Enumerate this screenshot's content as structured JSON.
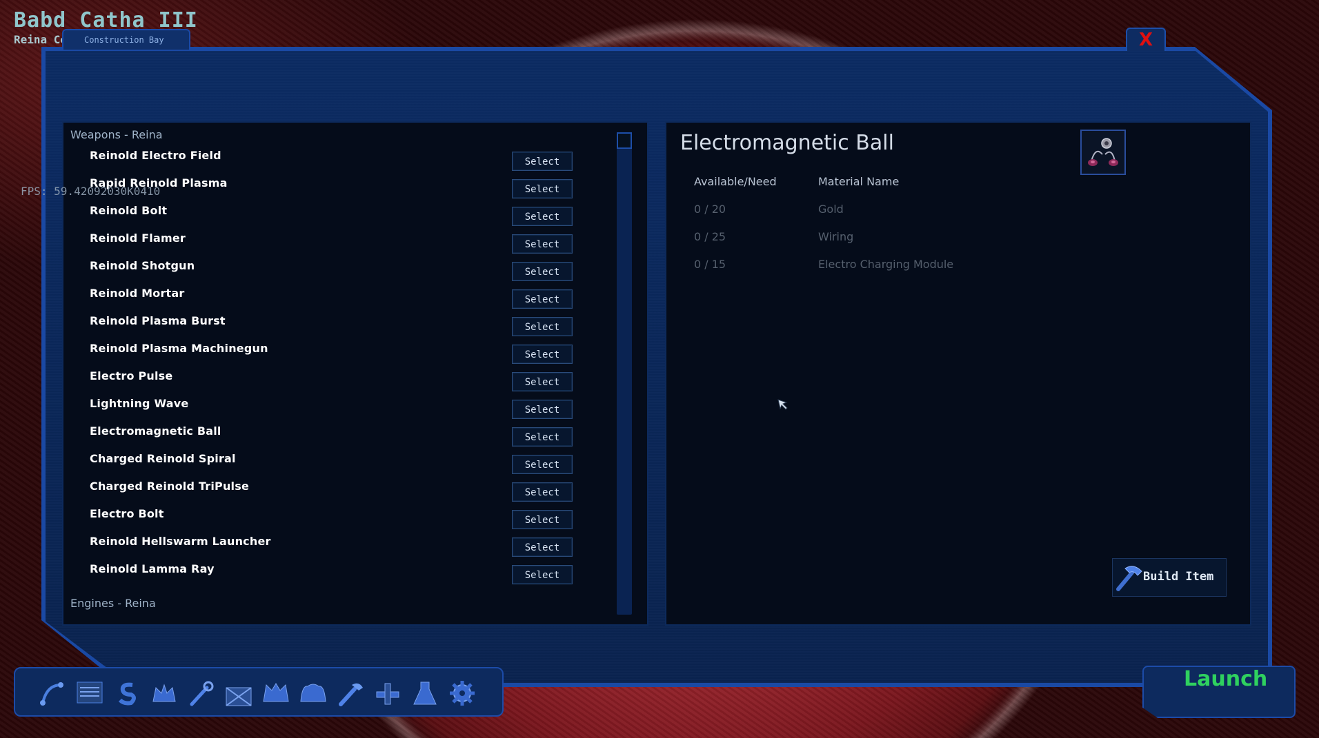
{
  "planet": {
    "name": "Babd Catha III",
    "subtitle": "Reina Co"
  },
  "tab": {
    "label": "Construction Bay"
  },
  "close": {
    "label": "X"
  },
  "fps": "FPS: 59.42092030K0410",
  "list": {
    "category_weapons": "Weapons - Reina",
    "category_engines": "Engines - Reina",
    "select_label": "Select",
    "items": [
      {
        "name": "Reinold Electro Field"
      },
      {
        "name": "Rapid Reinold Plasma"
      },
      {
        "name": "Reinold Bolt"
      },
      {
        "name": "Reinold Flamer"
      },
      {
        "name": "Reinold Shotgun"
      },
      {
        "name": "Reinold Mortar"
      },
      {
        "name": "Reinold Plasma Burst"
      },
      {
        "name": "Reinold Plasma Machinegun"
      },
      {
        "name": "Electro Pulse"
      },
      {
        "name": "Lightning Wave"
      },
      {
        "name": "Electromagnetic Ball"
      },
      {
        "name": "Charged Reinold Spiral"
      },
      {
        "name": "Charged Reinold TriPulse"
      },
      {
        "name": "Electro Bolt"
      },
      {
        "name": "Reinold Hellswarm Launcher"
      },
      {
        "name": "Reinold Lamma Ray"
      }
    ]
  },
  "detail": {
    "title": "Electromagnetic Ball",
    "col_available": "Available/Need",
    "col_material": "Material Name",
    "materials": [
      {
        "qty": "0 / 20",
        "name": "Gold"
      },
      {
        "qty": "0 / 25",
        "name": "Wiring"
      },
      {
        "qty": "0 / 15",
        "name": "Electro Charging Module"
      }
    ],
    "build_label": "Build Item"
  },
  "launch": {
    "label": "Launch"
  },
  "toolbar": {
    "icons": [
      "route-icon",
      "list-icon",
      "credits-icon",
      "ship-icon",
      "wrench-icon",
      "cargo-icon",
      "fleet-icon",
      "crew-icon",
      "repair-icon",
      "station-icon",
      "flask-icon",
      "gear-icon"
    ]
  },
  "colors": {
    "accent": "#1c4ba8",
    "panel": "#050c1a",
    "launch": "#2fd15f",
    "close": "#e01010"
  }
}
